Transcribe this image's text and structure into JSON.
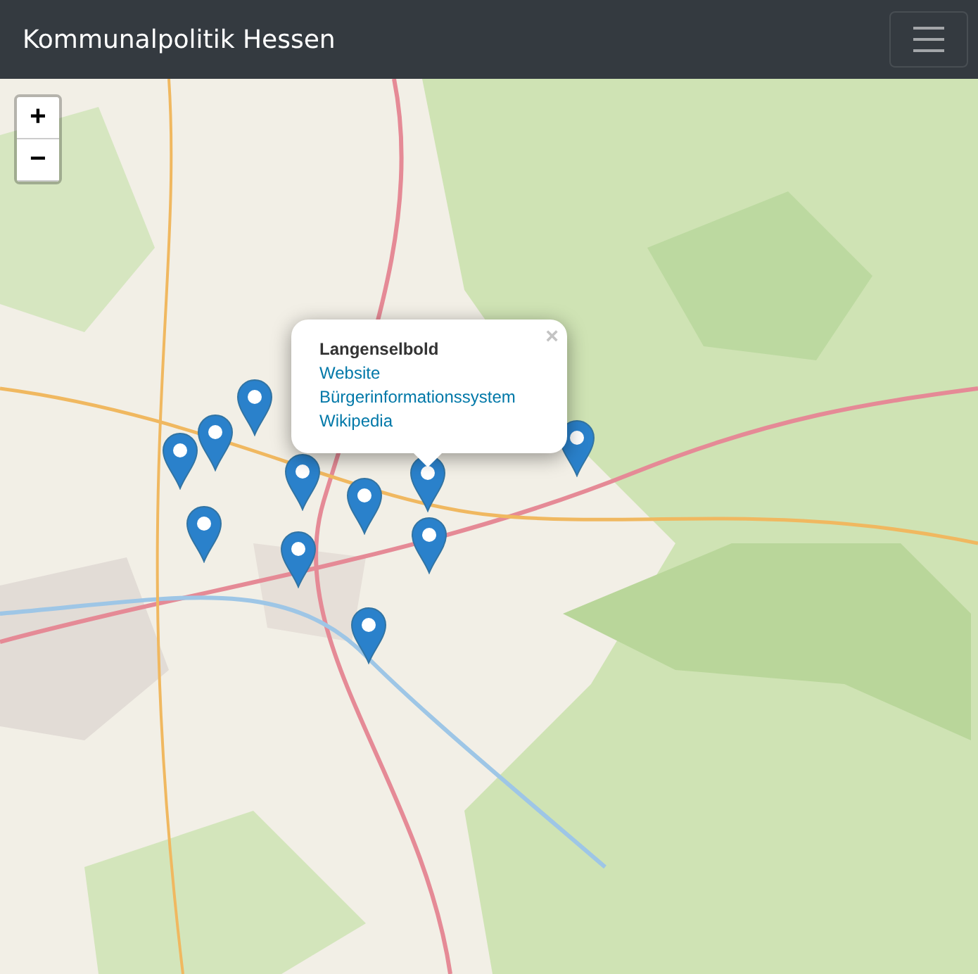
{
  "navbar": {
    "brand": "Kommunalpolitik Hessen"
  },
  "map": {
    "kind": "picture",
    "zoom_in": "+",
    "zoom_out": "−"
  },
  "popup": {
    "title": "Langenselbold",
    "close": "×",
    "links": [
      "Website",
      "Bürgerinformationssystem",
      "Wikipedia"
    ]
  }
}
